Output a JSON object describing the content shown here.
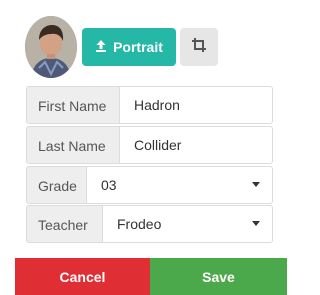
{
  "toolbar": {
    "portrait_label": "Portrait",
    "portrait_icon": "upload-icon",
    "crop_icon": "crop-icon"
  },
  "form": {
    "first_name": {
      "label": "First Name",
      "value": "Hadron"
    },
    "last_name": {
      "label": "Last Name",
      "value": "Collider"
    },
    "grade": {
      "label": "Grade",
      "value": "03"
    },
    "teacher": {
      "label": "Teacher",
      "value": "Frodeo"
    }
  },
  "actions": {
    "cancel_label": "Cancel",
    "save_label": "Save"
  },
  "colors": {
    "accent": "#25b8a6",
    "cancel": "#e02f34",
    "save": "#4ba84b"
  }
}
